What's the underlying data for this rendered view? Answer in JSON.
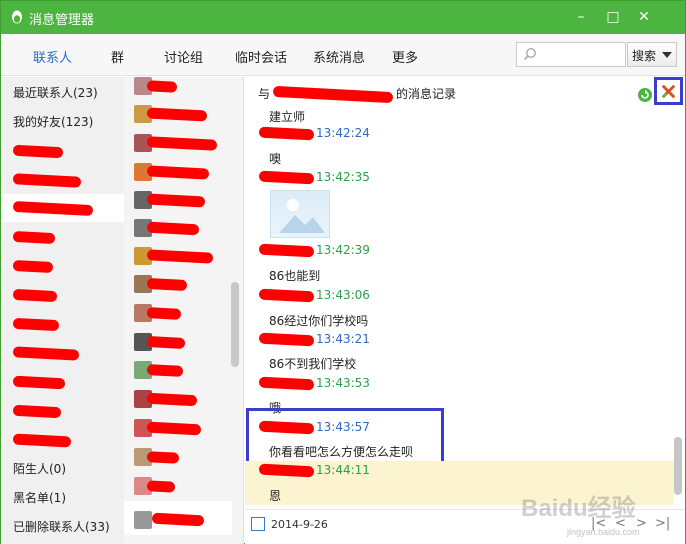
{
  "window": {
    "title": "消息管理器",
    "minimize": "–",
    "maximize": "□",
    "close": "✕"
  },
  "tabs": [
    "联系人",
    "群",
    "讨论组",
    "临时会话",
    "系统消息",
    "更多"
  ],
  "search": {
    "placeholder": "",
    "button_label": "搜索"
  },
  "categories": [
    "最近联系人(23)",
    "我的好友(123)",
    "",
    "",
    "",
    "",
    "",
    "",
    "",
    "",
    "",
    "",
    "",
    "陌生人(0)",
    "黑名单(1)",
    "已删除联系人(33)"
  ],
  "history": {
    "header_prefix": "与",
    "header_suffix": "的消息记录",
    "messages": [
      {
        "time": "",
        "text": "建立师",
        "color": "blue"
      },
      {
        "time": "13:42:24",
        "text": "噢",
        "color": "blue"
      },
      {
        "time": "13:42:35",
        "text": "",
        "color": "green"
      },
      {
        "time": "13:42:39",
        "text": "86也能到",
        "color": "green"
      },
      {
        "time": "13:43:06",
        "text": "86经过你们学校吗",
        "color": "green"
      },
      {
        "time": "13:43:21",
        "text": "86不到我们学校",
        "color": "blue"
      },
      {
        "time": "13:43:53",
        "text": "哦",
        "color": "green"
      },
      {
        "time": "13:43:57",
        "text": "你看看吧怎么方便怎么走呗",
        "color": "blue"
      },
      {
        "time": "13:44:11",
        "text": "恩",
        "color": "green"
      }
    ]
  },
  "footer": {
    "date": "2014-9-26",
    "pager": [
      "|<",
      "<",
      ">",
      ">|"
    ]
  },
  "watermark": {
    "brand": "Baidu经验",
    "url": "jingyan.baidu.com"
  },
  "colors": {
    "titlebar": "#4cb53f",
    "accent_blue": "#2b6cc4",
    "accent_green": "#2aa14a",
    "redaction": "#ff0000",
    "highlight_border": "#3b3ec8"
  }
}
